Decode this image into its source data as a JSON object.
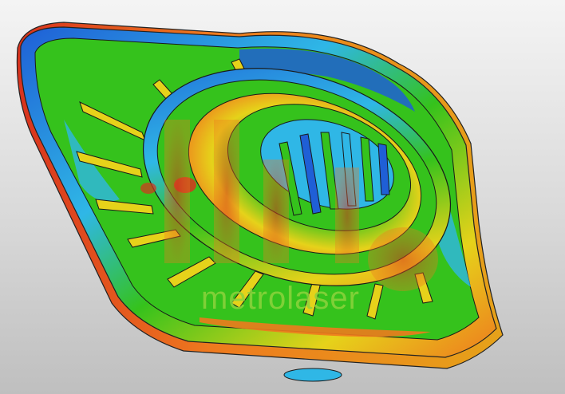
{
  "viewer": {
    "watermark_text": "metrolaser"
  },
  "colors": {
    "background_top": "#f4f4f4",
    "background_bottom": "#bfbfbf",
    "contour_blue": "#1f5fd6",
    "contour_cyan": "#2fb7e6",
    "contour_green": "#35c21c",
    "contour_yellow": "#e6d21a",
    "contour_orange": "#ee7a1e",
    "contour_red": "#d8321e",
    "watermark": "#8cd23c"
  },
  "icons": {
    "part_model": "cae-stress-contour-model",
    "logo": "metrolaser-logo"
  }
}
